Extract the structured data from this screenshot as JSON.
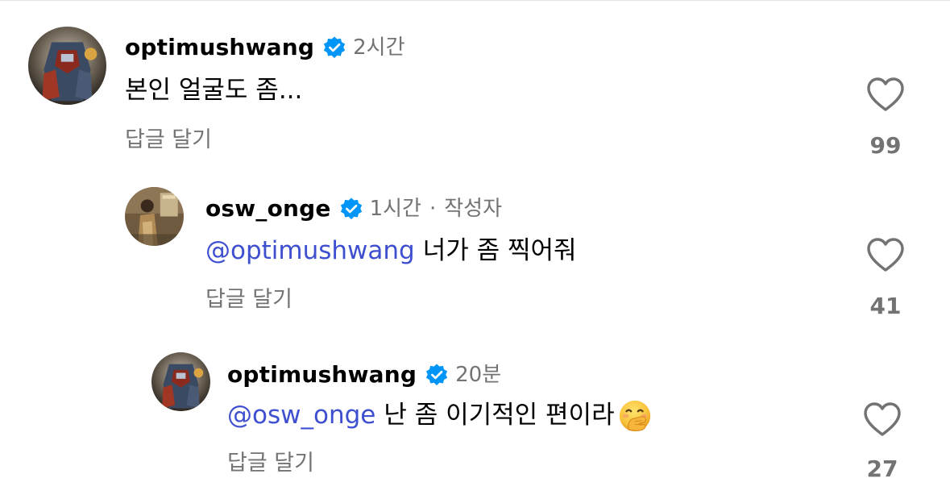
{
  "comments": [
    {
      "username": "optimushwang",
      "time": "2시간",
      "text": "본인 얼굴도 좀...",
      "reply_label": "답글 달기",
      "likes": "99",
      "verified": true
    },
    {
      "username": "osw_onge",
      "time": "1시간",
      "separator": "·",
      "author_badge": "작성자",
      "mention": "@optimushwang",
      "text": "너가 좀 찍어줘",
      "reply_label": "답글 달기",
      "likes": "41",
      "verified": true
    },
    {
      "username": "optimushwang",
      "time": "20분",
      "mention": "@osw_onge",
      "text": "난 좀 이기적인 편이라",
      "emoji": "face-with-hand-over-mouth-emoji",
      "reply_label": "답글 달기",
      "likes": "27",
      "verified": true
    }
  ],
  "colors": {
    "mention": "#3e4fcf",
    "muted": "#737373",
    "verified": "#0095f6",
    "text": "#000000"
  }
}
